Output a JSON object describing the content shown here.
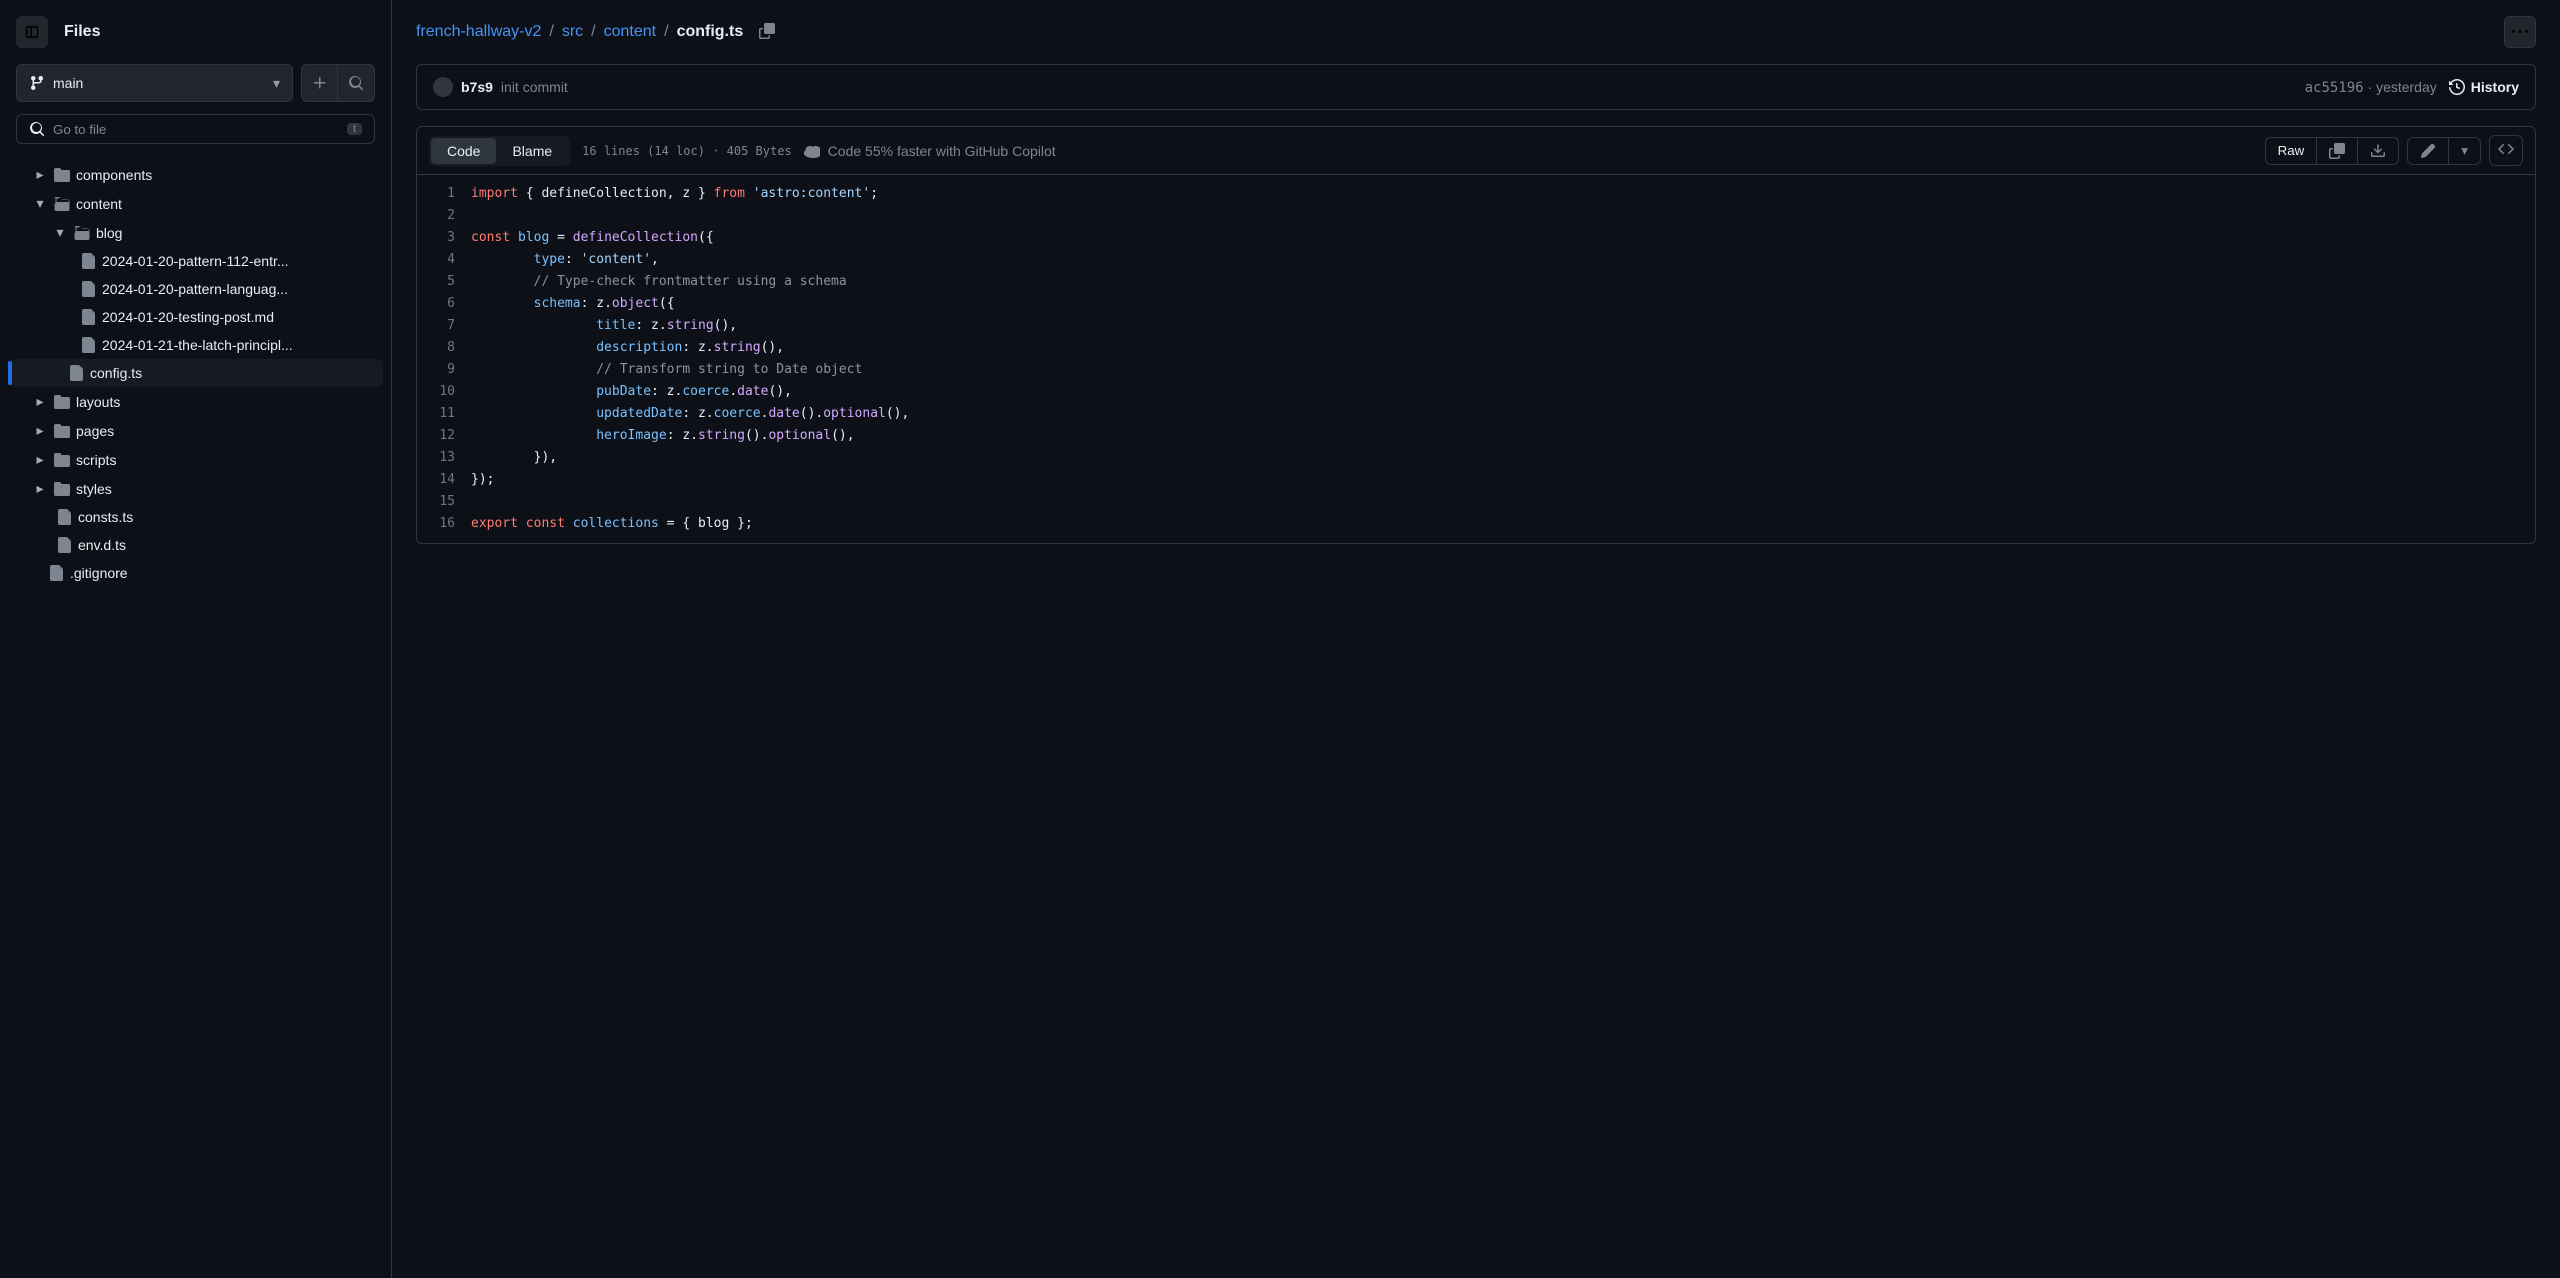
{
  "sidebar": {
    "title": "Files",
    "branch": "main",
    "search_placeholder": "Go to file",
    "search_kbd": "t",
    "tree": {
      "components": "components",
      "content": "content",
      "blog": "blog",
      "files": {
        "f1": "2024-01-20-pattern-112-entr...",
        "f2": "2024-01-20-pattern-languag...",
        "f3": "2024-01-20-testing-post.md",
        "f4": "2024-01-21-the-latch-principl...",
        "config": "config.ts"
      },
      "layouts": "layouts",
      "pages": "pages",
      "scripts": "scripts",
      "styles": "styles",
      "consts": "consts.ts",
      "env": "env.d.ts",
      "gitignore": ".gitignore"
    }
  },
  "breadcrumb": {
    "repo": "french-hallway-v2",
    "p1": "src",
    "p2": "content",
    "current": "config.ts"
  },
  "commit": {
    "author": "b7s9",
    "message": "init commit",
    "sha": "ac55196",
    "when": "yesterday",
    "history": "History"
  },
  "toolbar": {
    "code_tab": "Code",
    "blame_tab": "Blame",
    "stats": "16 lines (14 loc) · 405 Bytes",
    "copilot": "Code 55% faster with GitHub Copilot",
    "raw": "Raw"
  },
  "code": {
    "line_count": 16,
    "tokens": {
      "import": "import",
      "from": "from",
      "const": "const",
      "export": "export",
      "defineCollection": "defineCollection",
      "z": "z",
      "astro_content": "'astro:content'",
      "blog": "blog",
      "type": "type",
      "content_str": "'content'",
      "comment1": "// Type-check frontmatter using a schema",
      "schema": "schema",
      "object": "object",
      "title": "title",
      "string": "string",
      "description": "description",
      "comment2": "// Transform string to Date object",
      "pubDate": "pubDate",
      "coerce": "coerce",
      "date": "date",
      "updatedDate": "updatedDate",
      "optional": "optional",
      "heroImage": "heroImage",
      "collections": "collections"
    }
  }
}
